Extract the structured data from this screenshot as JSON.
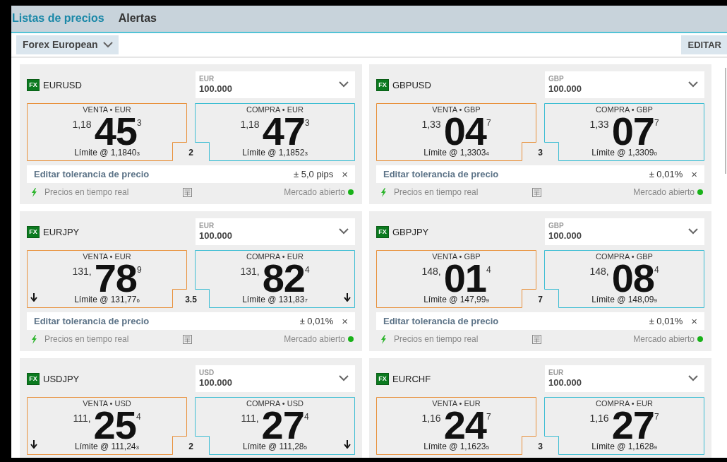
{
  "tabs": [
    {
      "label": "Listas de precios",
      "selected": true
    },
    {
      "label": "Alertas",
      "selected": false
    }
  ],
  "list_selector": {
    "value": "Forex European"
  },
  "edit_button": "EDITAR",
  "cards": [
    {
      "badge": "FX",
      "symbol": "EURUSD",
      "amount": {
        "label": "EUR",
        "value": "100.000"
      },
      "sell": {
        "label": "VENTA • EUR",
        "prefix": "1,18",
        "pips": "45",
        "fraction": "3",
        "limit": "Límite @ 1,1840$_{3}$",
        "falling": false
      },
      "buy": {
        "label": "COMPRA • EUR",
        "prefix": "1,18",
        "pips": "47",
        "fraction": "3",
        "limit": "Límite @ 1,1852$_{3}$",
        "falling": false
      },
      "spread": "2",
      "tolerance": {
        "label": "Editar tolerancia de precio",
        "value": "± 5,0 pips",
        "clear": "×"
      },
      "footer": {
        "realtime": "Precios en tiempo real",
        "market": "Mercado abierto",
        "color": "#19b219"
      }
    },
    {
      "badge": "FX",
      "symbol": "GBPUSD",
      "amount": {
        "label": "GBP",
        "value": "100.000"
      },
      "sell": {
        "label": "VENTA • GBP",
        "prefix": "1,33",
        "pips": "04",
        "fraction": "7",
        "limit": "Límite @ 1,3303$_{4}$",
        "falling": false
      },
      "buy": {
        "label": "COMPRA • GBP",
        "prefix": "1,33",
        "pips": "07",
        "fraction": "7",
        "limit": "Límite @ 1,3309$_{0}$",
        "falling": false
      },
      "spread": "3",
      "tolerance": {
        "label": "Editar tolerancia de precio",
        "value": "± 0,01%",
        "clear": "×"
      },
      "footer": {
        "realtime": "Precios en tiempo real",
        "market": "Mercado abierto",
        "color": "#19b219"
      }
    },
    {
      "badge": "FX",
      "symbol": "EURJPY",
      "amount": {
        "label": "EUR",
        "value": "100.000"
      },
      "sell": {
        "label": "VENTA • EUR",
        "prefix": "131,",
        "pips": "78",
        "fraction": "9",
        "limit": "Límite @ 131,77$_{6}$",
        "falling": true
      },
      "buy": {
        "label": "COMPRA • EUR",
        "prefix": "131,",
        "pips": "82",
        "fraction": "4",
        "limit": "Límite @ 131,83$_{7}$",
        "falling": true
      },
      "spread": "3.5",
      "tolerance": {
        "label": "Editar tolerancia de precio",
        "value": "± 0,01%",
        "clear": "×"
      },
      "footer": {
        "realtime": "Precios en tiempo real",
        "market": "Mercado abierto",
        "color": "#19b219"
      }
    },
    {
      "badge": "FX",
      "symbol": "GBPJPY",
      "amount": {
        "label": "GBP",
        "value": "100.000"
      },
      "sell": {
        "label": "VENTA • GBP",
        "prefix": "148,",
        "pips": "01",
        "fraction": "4",
        "limit": "Límite @ 147,99$_{9}$",
        "falling": false
      },
      "buy": {
        "label": "COMPRA • GBP",
        "prefix": "148,",
        "pips": "08",
        "fraction": "4",
        "limit": "Límite @ 148,09$_{9}$",
        "falling": false
      },
      "spread": "7",
      "tolerance": {
        "label": "Editar tolerancia de precio",
        "value": "± 0,01%",
        "clear": "×"
      },
      "footer": {
        "realtime": "Precios en tiempo real",
        "market": "Mercado abierto",
        "color": "#19b219"
      }
    },
    {
      "badge": "FX",
      "symbol": "USDJPY",
      "amount": {
        "label": "USD",
        "value": "100.000"
      },
      "sell": {
        "label": "VENTA • USD",
        "prefix": "111,",
        "pips": "25",
        "fraction": "4",
        "limit": "Límite @ 111,24$_{3}$",
        "falling": true
      },
      "buy": {
        "label": "COMPRA • USD",
        "prefix": "111,",
        "pips": "27",
        "fraction": "4",
        "limit": "Límite @ 111,28$_{5}$",
        "falling": true
      },
      "spread": "2"
    },
    {
      "badge": "FX",
      "symbol": "EURCHF",
      "amount": {
        "label": "EUR",
        "value": "100.000"
      },
      "sell": {
        "label": "VENTA • EUR",
        "prefix": "1,16",
        "pips": "24",
        "fraction": "7",
        "limit": "Límite @ 1,1623$_{5}$",
        "falling": false
      },
      "buy": {
        "label": "COMPRA • EUR",
        "prefix": "1,16",
        "pips": "27",
        "fraction": "7",
        "limit": "Límite @ 1,1628$_{9}$",
        "falling": false
      },
      "spread": "3"
    }
  ]
}
